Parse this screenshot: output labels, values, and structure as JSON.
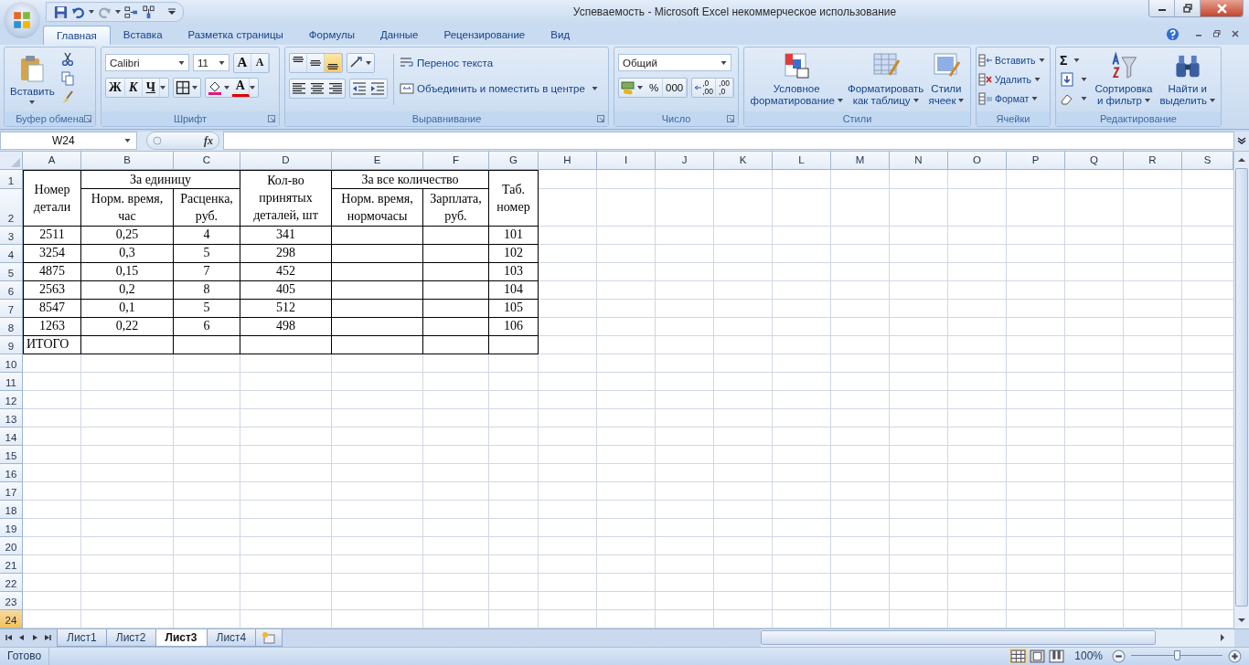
{
  "window": {
    "title": "Успеваемость - Microsoft Excel некоммерческое использование"
  },
  "ribbon_tabs": [
    {
      "label": "Главная",
      "selected": true
    },
    {
      "label": "Вставка",
      "selected": false
    },
    {
      "label": "Разметка страницы",
      "selected": false
    },
    {
      "label": "Формулы",
      "selected": false
    },
    {
      "label": "Данные",
      "selected": false
    },
    {
      "label": "Рецензирование",
      "selected": false
    },
    {
      "label": "Вид",
      "selected": false
    }
  ],
  "ribbon": {
    "clipboard": {
      "label": "Буфер обмена",
      "paste": "Вставить"
    },
    "font": {
      "label": "Шрифт",
      "font_name": "Calibri",
      "font_size": "11",
      "grow": "A",
      "shrink": "A",
      "bold": "Ж",
      "italic": "К",
      "underline": "Ч",
      "font_color": "A"
    },
    "alignment": {
      "label": "Выравнивание",
      "vertical_align": [
        {
          "selected": false
        },
        {
          "selected": false
        },
        {
          "selected": true
        }
      ],
      "wrap": "Перенос текста",
      "merge": "Объединить и поместить в центре"
    },
    "number": {
      "label": "Число",
      "format": "Общий",
      "percent": "%",
      "thousands": "000",
      "increase_decimal": [
        ",0",
        ",00"
      ],
      "decrease_decimal": [
        ",00",
        ",0"
      ]
    },
    "styles": {
      "label": "Стили",
      "buttons": [
        {
          "lines": [
            "Условное",
            "форматирование"
          ]
        },
        {
          "lines": [
            "Форматировать",
            "как таблицу"
          ]
        },
        {
          "lines": [
            "Стили",
            "ячеек"
          ]
        }
      ]
    },
    "cells": {
      "label": "Ячейки",
      "buttons": [
        "Вставить",
        "Удалить",
        "Формат"
      ]
    },
    "editing": {
      "label": "Редактирование",
      "sum": "Σ",
      "buttons": [
        {
          "lines": [
            "Сортировка",
            "и фильтр"
          ]
        },
        {
          "lines": [
            "Найти и",
            "выделить"
          ]
        }
      ]
    }
  },
  "formula_bar": {
    "name_box": "W24",
    "fx": "fx"
  },
  "sheet": {
    "columns": [
      "A",
      "B",
      "C",
      "D",
      "E",
      "F",
      "G",
      "H",
      "I",
      "J",
      "K",
      "L",
      "M",
      "N",
      "O",
      "P",
      "Q",
      "R",
      "S"
    ],
    "rows": [
      {
        "label": "1",
        "selected": false
      },
      {
        "label": "2",
        "selected": false
      },
      {
        "label": "3",
        "selected": false
      },
      {
        "label": "4",
        "selected": false
      },
      {
        "label": "5",
        "selected": false
      },
      {
        "label": "6",
        "selected": false
      },
      {
        "label": "7",
        "selected": false
      },
      {
        "label": "8",
        "selected": false
      },
      {
        "label": "9",
        "selected": false
      },
      {
        "label": "10",
        "selected": false
      },
      {
        "label": "11",
        "selected": false
      },
      {
        "label": "12",
        "selected": false
      },
      {
        "label": "13",
        "selected": false
      },
      {
        "label": "14",
        "selected": false
      },
      {
        "label": "15",
        "selected": false
      },
      {
        "label": "16",
        "selected": false
      },
      {
        "label": "17",
        "selected": false
      },
      {
        "label": "18",
        "selected": false
      },
      {
        "label": "19",
        "selected": false
      },
      {
        "label": "20",
        "selected": false
      },
      {
        "label": "21",
        "selected": false
      },
      {
        "label": "22",
        "selected": false
      },
      {
        "label": "23",
        "selected": false
      },
      {
        "label": "24",
        "selected": true
      }
    ],
    "table": {
      "header": [
        {
          "text": "Номер детали",
          "kind": "span"
        },
        {
          "text": "За единицу",
          "kind": "group"
        },
        {
          "text": "Норм. время, час",
          "kind": "sub"
        },
        {
          "text": "Расценка, руб.",
          "kind": "sub"
        },
        {
          "text": "Кол-во принятых деталей, шт",
          "kind": "span"
        },
        {
          "text": "За все количество",
          "kind": "group"
        },
        {
          "text": "Норм. время, нормочасы",
          "kind": "sub"
        },
        {
          "text": "Зарплата, руб.",
          "kind": "sub"
        },
        {
          "text": "Таб. номер",
          "kind": "span"
        }
      ],
      "rows": [
        {
          "kind": "data",
          "cells": [
            "2511",
            "0,25",
            "4",
            "341",
            null,
            null,
            "101"
          ]
        },
        {
          "kind": "data",
          "cells": [
            "3254",
            "0,3",
            "5",
            "298",
            null,
            null,
            "102"
          ]
        },
        {
          "kind": "data",
          "cells": [
            "4875",
            "0,15",
            "7",
            "452",
            null,
            null,
            "103"
          ]
        },
        {
          "kind": "data",
          "cells": [
            "2563",
            "0,2",
            "8",
            "405",
            null,
            null,
            "104"
          ]
        },
        {
          "kind": "data",
          "cells": [
            "8547",
            "0,1",
            "5",
            "512",
            null,
            null,
            "105"
          ]
        },
        {
          "kind": "data",
          "cells": [
            "1263",
            "0,22",
            "6",
            "498",
            null,
            null,
            "106"
          ]
        },
        {
          "kind": "total",
          "cells": [
            "ИТОГО",
            null,
            null,
            null,
            null,
            null,
            null
          ]
        }
      ]
    }
  },
  "sheet_tabs": [
    {
      "label": "Лист1",
      "selected": false
    },
    {
      "label": "Лист2",
      "selected": false
    },
    {
      "label": "Лист3",
      "selected": true
    },
    {
      "label": "Лист4",
      "selected": false
    }
  ],
  "status_bar": {
    "status": "Готово",
    "zoom": "100%",
    "zoom_slider": {
      "level": 0.5
    }
  }
}
